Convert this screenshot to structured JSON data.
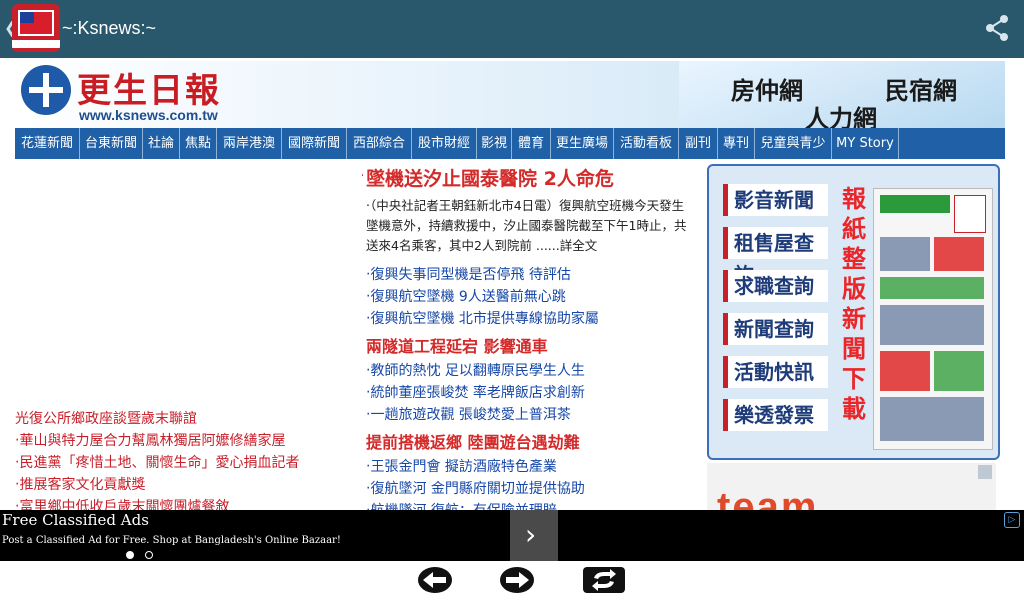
{
  "app": {
    "title": "~:Ksnews:~",
    "logo_icon": "ksnews-app-logo",
    "share_icon": "share-icon"
  },
  "site": {
    "name": "更生日報",
    "url": "www.ksnews.com.tw",
    "ad_banner": {
      "line1_left": "房仲網",
      "line1_right": "民宿網",
      "line2": "人力網"
    }
  },
  "nav": [
    "花蓮新聞",
    "台東新聞",
    "社論",
    "焦點",
    "兩岸港澳",
    "國際新聞",
    "西部綜合",
    "股市財經",
    "影視",
    "體育",
    "更生廣場",
    "活動看板",
    "副刊",
    "專刊",
    "兒童與青少",
    "MY Story"
  ],
  "left_column": {
    "heading": "光復公所鄉政座談暨歲末聯誼",
    "items": [
      "‧華山與特力屋合力幫鳳林獨居阿嬤修繕家屋",
      "‧民進黨「疼惜土地、關懷生命」愛心捐血記者",
      "‧推展客家文化貢獻獎",
      "‧富里鄉中低收戶歲末關懷團爐餐敘"
    ]
  },
  "main_news": {
    "headline": "墜機送汐止國泰醫院 2人命危",
    "lead": "‧（中央社記者王朝鈺新北市4日電）復興航空班機今天發生墜機意外，持續救援中，汐止國泰醫院截至下午1時止，共送來4名乘客，其中2人到院前 ......詳全文",
    "links1": [
      "‧復興失事同型機是否停飛 待評估",
      "‧復興航空墜機 9人送醫前無心跳",
      "‧復興航空墜機 北市提供專線協助家屬"
    ],
    "subhead1": "兩隧道工程延宕 影響通車",
    "links2": [
      "‧教師的熱忱 足以翻轉原民學生人生",
      "‧統帥董座張峻焚 率老牌飯店求創新",
      "‧一趟旅遊改觀 張峻焚愛上普洱茶"
    ],
    "subhead2": "提前搭機返鄉 陸團遊台遇劫難",
    "links3": [
      "‧王張金門會 擬訪酒廠特色產業",
      "‧復航墜河 金門縣府關切並提供協助",
      "‧航機墜河 復航：有保險並理賠"
    ]
  },
  "right_panel": {
    "menu": [
      "影音新聞",
      "租售屋查詢",
      "求職查詢",
      "新聞查詢",
      "活動快訊",
      "樂透發票"
    ],
    "vertical_text": "報紙整版新聞下載"
  },
  "team_ad": {
    "text": "team"
  },
  "ad_bar": {
    "title": "Free Classified Ads",
    "subtitle": "Post a Classified Ad for Free. Shop at Bangladesh's Online Bazaar!",
    "adchoice": "▷"
  },
  "bottom_controls": [
    "back-arrow-icon",
    "forward-arrow-icon",
    "refresh-icon"
  ]
}
